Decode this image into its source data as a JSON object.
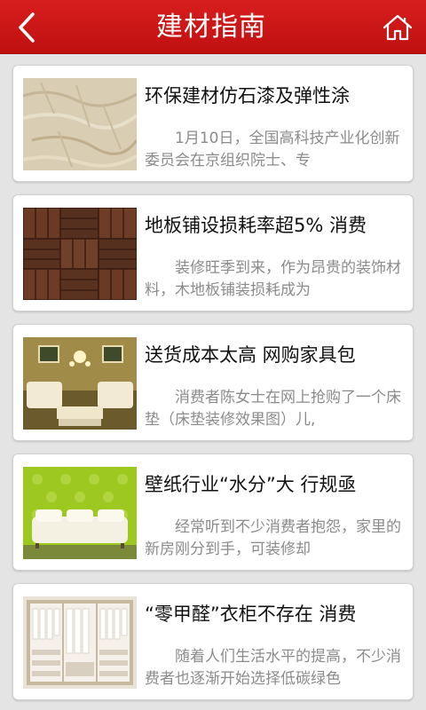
{
  "header": {
    "title": "建材指南",
    "back_icon": "chevron-left-icon",
    "home_icon": "home-icon",
    "background_color": "#cc1616"
  },
  "articles": [
    {
      "title": "环保建材仿石漆及弹性涂",
      "summary": "1月10日，全国高科技产业化创新委员会在京组织院士、专",
      "thumbnail": "stone-texture-image"
    },
    {
      "title": "地板铺设损耗率超5% 消费",
      "summary": "装修旺季到来，作为昂贵的装饰材料，木地板铺装损耗成为",
      "thumbnail": "wood-parquet-image"
    },
    {
      "title": "送货成本太高 网购家具包",
      "summary": "消费者陈女士在网上抢购了一个床垫（床垫装修效果图）儿,",
      "thumbnail": "living-room-image"
    },
    {
      "title": "壁纸行业“水分”大 行规亟",
      "summary": "经常听到不少消费者抱怨，家里的新房刚分到手，可装修却",
      "thumbnail": "green-wallpaper-sofa-image"
    },
    {
      "title": "“零甲醛”衣柜不存在 消费",
      "summary": "随着人们生活水平的提高，不少消费者也逐渐开始选择低碳绿色",
      "thumbnail": "wardrobe-image"
    }
  ]
}
